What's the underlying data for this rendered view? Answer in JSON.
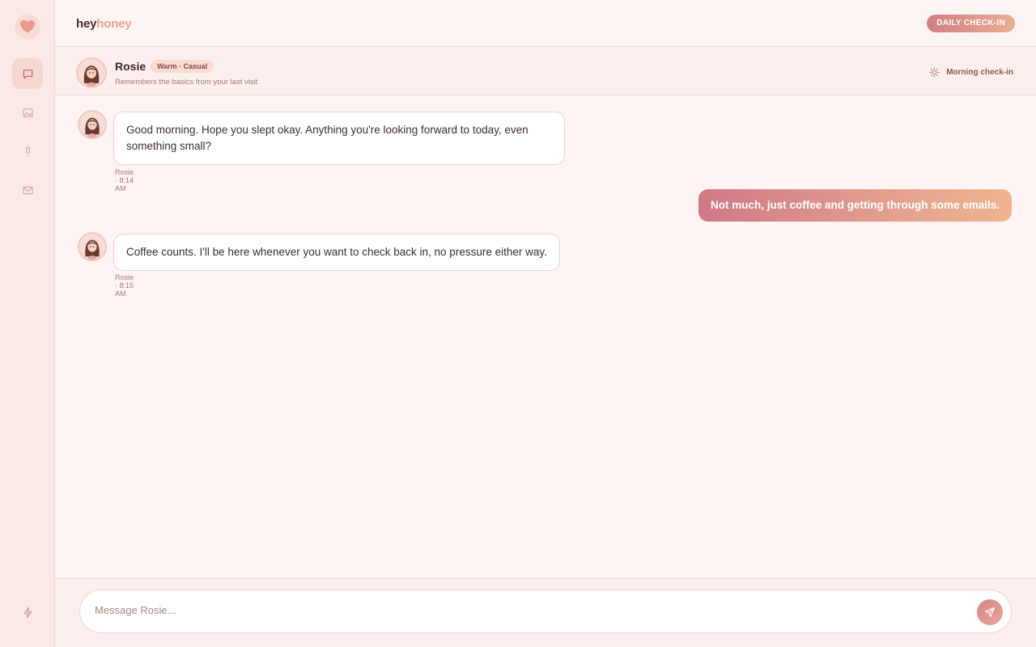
{
  "app": {
    "brand_part1": "hey",
    "brand_part2": "honey",
    "primary_action": "DAILY CHECK-IN"
  },
  "sidebar": {
    "logo_icon": "heart-icon",
    "items": [
      {
        "icon": "chat-icon",
        "active": true
      },
      {
        "icon": "image-icon",
        "active": false
      },
      {
        "icon": "microphone-icon",
        "active": false
      },
      {
        "icon": "mail-icon",
        "active": false
      }
    ],
    "bottom_icon": "lightning-icon"
  },
  "persona": {
    "name": "Rosie",
    "tag": "Warm · Casual",
    "subtitle": "Remembers the basics from your last visit",
    "mode_label": "Morning check-in",
    "mode_icon": "sun-icon"
  },
  "messages": [
    {
      "from": "bot",
      "text": "Good morning. Hope you slept okay. Anything you're looking forward to today, even something small?",
      "meta": "Rosie · 8:14 AM"
    },
    {
      "from": "user",
      "text": "Not much, just coffee and getting through some emails."
    },
    {
      "from": "bot",
      "text": "Coffee counts. I'll be here whenever you want to check back in, no pressure either way.",
      "meta": "Rosie · 8:15 AM"
    }
  ],
  "composer": {
    "placeholder": "Message Rosie...",
    "value": "",
    "send_icon": "send-icon"
  },
  "colors": {
    "accent_start": "#d27d86",
    "accent_end": "#e9ae91",
    "background": "#fdf4f3",
    "rail": "#fbe9e7"
  }
}
